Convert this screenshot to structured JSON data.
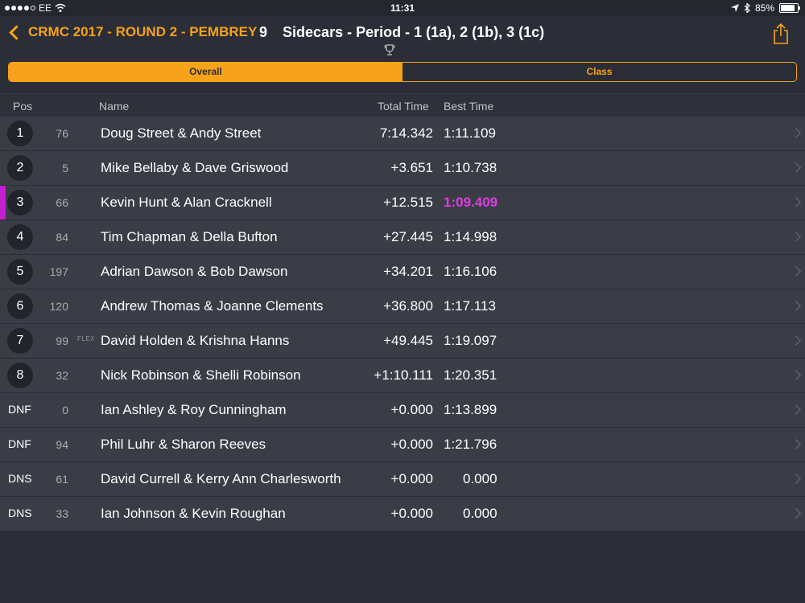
{
  "status": {
    "carrier": "EE",
    "time": "11:31",
    "battery": "85%",
    "battery_level": 0.85
  },
  "nav": {
    "back_label": "CRMC 2017 - ROUND 2 - PEMBREY",
    "race_number": "9",
    "race_title": "Sidecars - Period - 1 (1a), 2 (1b), 3 (1c)"
  },
  "segments": {
    "overall": "Overall",
    "class": "Class"
  },
  "columns": {
    "pos": "Pos",
    "name": "Name",
    "total": "Total Time",
    "best": "Best Time"
  },
  "colors": {
    "accent": "#f7a21b",
    "highlight": "#e23be6",
    "background": "#2b2e37",
    "row": "#3a3d46"
  },
  "rows": [
    {
      "pos": "1",
      "no": "76",
      "flex": "",
      "name": "Doug Street & Andy Street",
      "total": "7:14.342",
      "best": "1:11.109"
    },
    {
      "pos": "2",
      "no": "5",
      "flex": "",
      "name": "Mike Bellaby & Dave Griswood",
      "total": "+3.651",
      "best": "1:10.738"
    },
    {
      "pos": "3",
      "no": "66",
      "flex": "",
      "name": "Kevin Hunt & Alan Cracknell",
      "total": "+12.515",
      "best": "1:09.409"
    },
    {
      "pos": "4",
      "no": "84",
      "flex": "",
      "name": "Tim Chapman & Della Bufton",
      "total": "+27.445",
      "best": "1:14.998"
    },
    {
      "pos": "5",
      "no": "197",
      "flex": "",
      "name": "Adrian Dawson & Bob Dawson",
      "total": "+34.201",
      "best": "1:16.106"
    },
    {
      "pos": "6",
      "no": "120",
      "flex": "",
      "name": "Andrew Thomas & Joanne Clements",
      "total": "+36.800",
      "best": "1:17.113"
    },
    {
      "pos": "7",
      "no": "99",
      "flex": "FLEX",
      "name": "David Holden & Krishna Hanns",
      "total": "+49.445",
      "best": "1:19.097"
    },
    {
      "pos": "8",
      "no": "32",
      "flex": "",
      "name": "Nick Robinson & Shelli Robinson",
      "total": "+1:10.111",
      "best": "1:20.351"
    },
    {
      "pos": "DNF",
      "no": "0",
      "flex": "",
      "name": "Ian Ashley & Roy Cunningham",
      "total": "+0.000",
      "best": "1:13.899"
    },
    {
      "pos": "DNF",
      "no": "94",
      "flex": "",
      "name": "Phil Luhr & Sharon Reeves",
      "total": "+0.000",
      "best": "1:21.796"
    },
    {
      "pos": "DNS",
      "no": "61",
      "flex": "",
      "name": "David Currell & Kerry Ann Charlesworth",
      "total": "+0.000",
      "best": "0.000"
    },
    {
      "pos": "DNS",
      "no": "33",
      "flex": "",
      "name": "Ian Johnson & Kevin Roughan",
      "total": "+0.000",
      "best": "0.000"
    }
  ]
}
